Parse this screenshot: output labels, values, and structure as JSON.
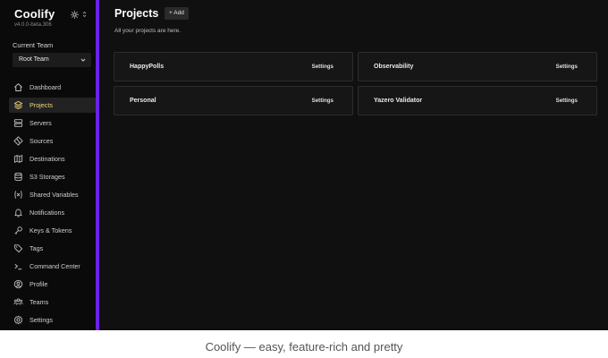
{
  "app": {
    "name": "Coolify",
    "version": "v4.0.0-beta.306",
    "accent_color": "#6b21e8",
    "active_color": "#f4d57c"
  },
  "theme_toggle": {
    "icon": "sun-icon",
    "chevron": "chevron-updown-icon"
  },
  "team": {
    "label": "Current Team",
    "selected": "Root Team"
  },
  "sidebar": {
    "items": [
      {
        "label": "Dashboard",
        "icon": "home-icon",
        "active": false
      },
      {
        "label": "Projects",
        "icon": "layers-icon",
        "active": true
      },
      {
        "label": "Servers",
        "icon": "server-icon",
        "active": false
      },
      {
        "label": "Sources",
        "icon": "git-branch-icon",
        "active": false
      },
      {
        "label": "Destinations",
        "icon": "map-icon",
        "active": false
      },
      {
        "label": "S3 Storages",
        "icon": "database-icon",
        "active": false
      },
      {
        "label": "Shared Variables",
        "icon": "variable-icon",
        "active": false
      },
      {
        "label": "Notifications",
        "icon": "bell-icon",
        "active": false
      },
      {
        "label": "Keys & Tokens",
        "icon": "key-icon",
        "active": false
      },
      {
        "label": "Tags",
        "icon": "tag-icon",
        "active": false
      },
      {
        "label": "Command Center",
        "icon": "terminal-icon",
        "active": false
      },
      {
        "label": "Profile",
        "icon": "user-circle-icon",
        "active": false
      },
      {
        "label": "Teams",
        "icon": "users-icon",
        "active": false
      },
      {
        "label": "Settings",
        "icon": "gear-icon",
        "active": false
      }
    ]
  },
  "main": {
    "title": "Projects",
    "add_label": "+ Add",
    "subtitle": "All your projects are here.",
    "projects": [
      {
        "name": "HappyPolls",
        "settings_label": "Settings"
      },
      {
        "name": "Observability",
        "settings_label": "Settings"
      },
      {
        "name": "Personal",
        "settings_label": "Settings"
      },
      {
        "name": "Yazero Validator",
        "settings_label": "Settings"
      }
    ]
  },
  "caption": "Coolify — easy, feature-rich and pretty"
}
